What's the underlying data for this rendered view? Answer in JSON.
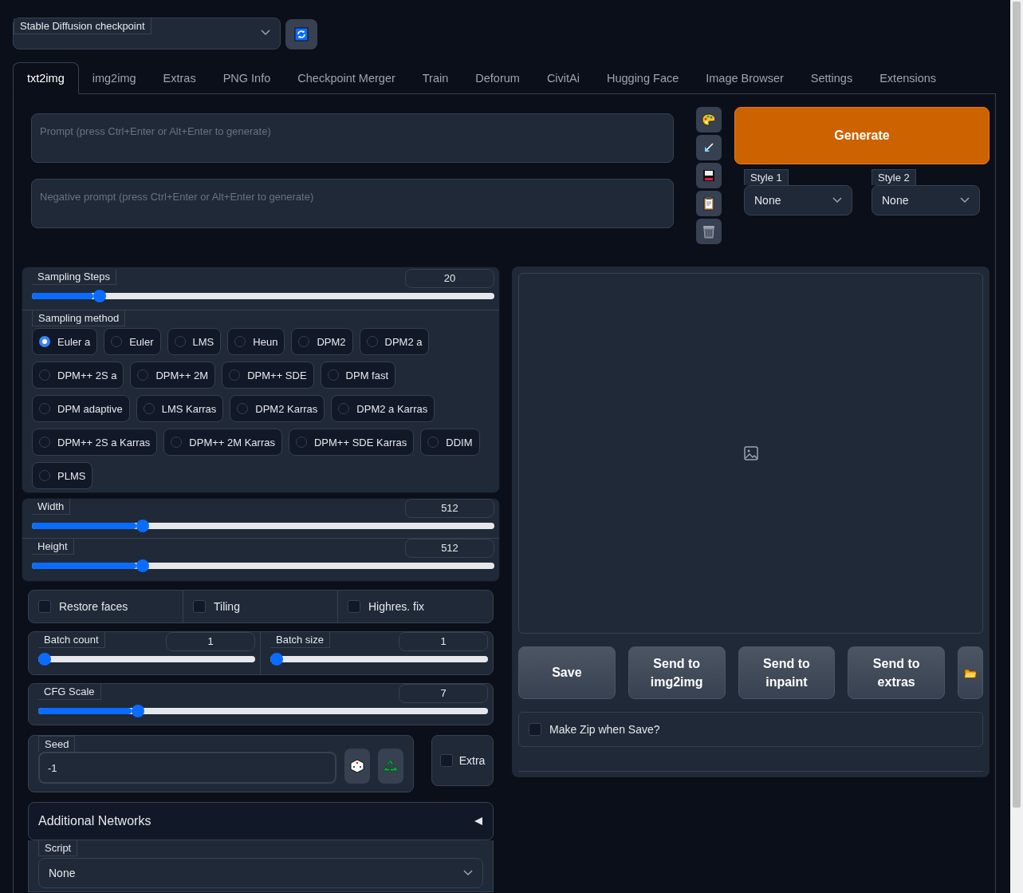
{
  "checkpoint": {
    "label": "Stable Diffusion checkpoint"
  },
  "tabs": [
    {
      "label": "txt2img",
      "selected": true
    },
    {
      "label": "img2img",
      "selected": false
    },
    {
      "label": "Extras",
      "selected": false
    },
    {
      "label": "PNG Info",
      "selected": false
    },
    {
      "label": "Checkpoint Merger",
      "selected": false
    },
    {
      "label": "Train",
      "selected": false
    },
    {
      "label": "Deforum",
      "selected": false
    },
    {
      "label": "CivitAi",
      "selected": false
    },
    {
      "label": "Hugging Face",
      "selected": false
    },
    {
      "label": "Image Browser",
      "selected": false
    },
    {
      "label": "Settings",
      "selected": false
    },
    {
      "label": "Extensions",
      "selected": false
    }
  ],
  "prompt": {
    "placeholder": "Prompt (press Ctrl+Enter or Alt+Enter to generate)"
  },
  "negative_prompt": {
    "placeholder": "Negative prompt (press Ctrl+Enter or Alt+Enter to generate)"
  },
  "generate_button": "Generate",
  "styles": [
    {
      "label": "Style 1",
      "value": "None"
    },
    {
      "label": "Style 2",
      "value": "None"
    }
  ],
  "sampling_steps": {
    "label": "Sampling Steps",
    "value": "20",
    "level": 0.137
  },
  "sampling_method": {
    "label": "Sampling method",
    "options": [
      {
        "label": "Euler a",
        "selected": true
      },
      {
        "label": "Euler",
        "selected": false
      },
      {
        "label": "LMS",
        "selected": false
      },
      {
        "label": "Heun",
        "selected": false
      },
      {
        "label": "DPM2",
        "selected": false
      },
      {
        "label": "DPM2 a",
        "selected": false
      },
      {
        "label": "DPM++ 2S a",
        "selected": false
      },
      {
        "label": "DPM++ 2M",
        "selected": false
      },
      {
        "label": "DPM++ SDE",
        "selected": false
      },
      {
        "label": "DPM fast",
        "selected": false
      },
      {
        "label": "DPM adaptive",
        "selected": false
      },
      {
        "label": "LMS Karras",
        "selected": false
      },
      {
        "label": "DPM2 Karras",
        "selected": false
      },
      {
        "label": "DPM2 a Karras",
        "selected": false
      },
      {
        "label": "DPM++ 2S a Karras",
        "selected": false
      },
      {
        "label": "DPM++ 2M Karras",
        "selected": false
      },
      {
        "label": "DPM++ SDE Karras",
        "selected": false
      },
      {
        "label": "DDIM",
        "selected": false
      },
      {
        "label": "PLMS",
        "selected": false
      }
    ]
  },
  "width": {
    "label": "Width",
    "value": "512",
    "level": 0.232
  },
  "height": {
    "label": "Height",
    "value": "512",
    "level": 0.232
  },
  "checkboxes": [
    {
      "label": "Restore faces",
      "checked": false
    },
    {
      "label": "Tiling",
      "checked": false
    },
    {
      "label": "Highres. fix",
      "checked": false
    }
  ],
  "batch_count": {
    "label": "Batch count",
    "value": "1",
    "level": 0.0
  },
  "batch_size": {
    "label": "Batch size",
    "value": "1",
    "level": 0.0
  },
  "cfg_scale": {
    "label": "CFG Scale",
    "value": "7",
    "level": 0.214
  },
  "seed": {
    "label": "Seed",
    "value": "-1"
  },
  "extra": {
    "label": "Extra",
    "checked": false
  },
  "additional_networks": {
    "title": "Additional Networks",
    "expanded": false
  },
  "script": {
    "label": "Script",
    "value": "None"
  },
  "output_buttons": [
    "Save",
    "Send to img2img",
    "Send to inpaint",
    "Send to extras"
  ],
  "make_zip": {
    "label": "Make Zip when Save?",
    "checked": false
  }
}
